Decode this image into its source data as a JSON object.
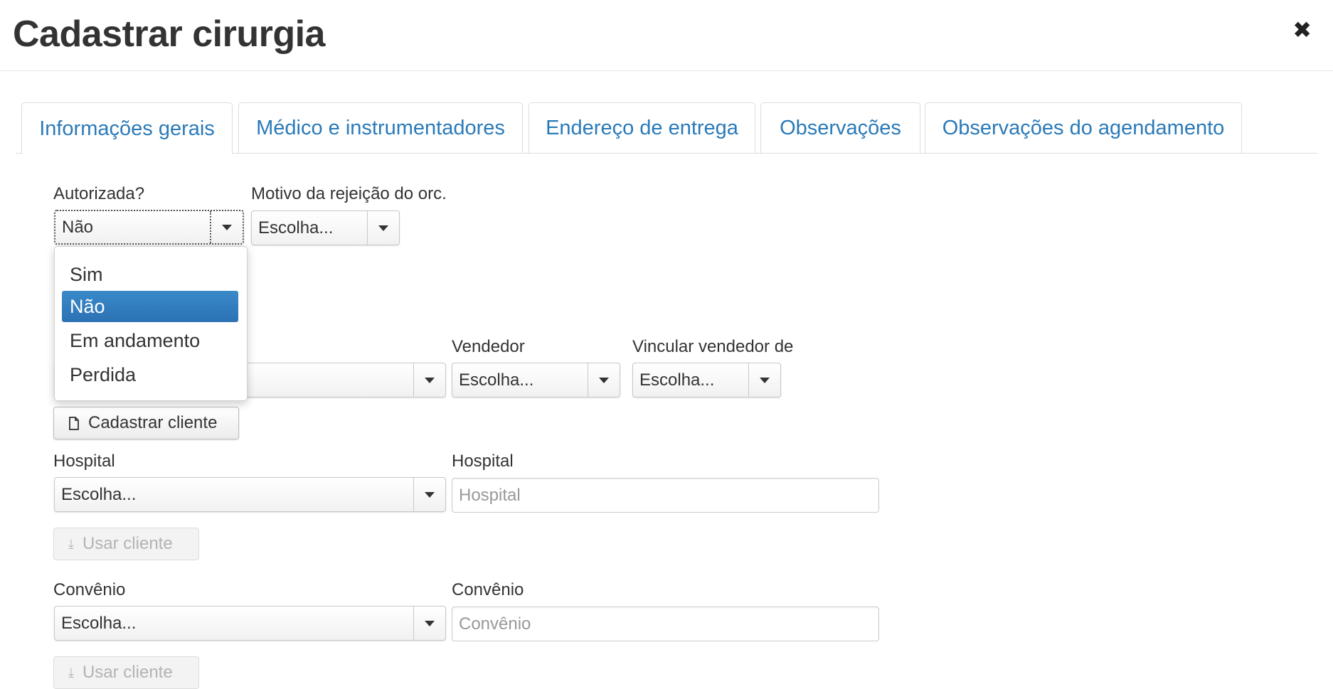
{
  "modal": {
    "title": "Cadastrar cirurgia",
    "close_symbol": "✖"
  },
  "tabs": [
    {
      "label": "Informações gerais",
      "active": true
    },
    {
      "label": "Médico e instrumentadores",
      "active": false
    },
    {
      "label": "Endereço de entrega",
      "active": false
    },
    {
      "label": "Observações",
      "active": false
    },
    {
      "label": "Observações do agendamento",
      "active": false
    }
  ],
  "form": {
    "autorizada": {
      "label": "Autorizada?",
      "value": "Não",
      "options": [
        "Sim",
        "Não",
        "Em andamento",
        "Perdida"
      ],
      "selected_option": "Não"
    },
    "motivo_rejeicao": {
      "label": "Motivo da rejeição do orc.",
      "value": "Escolha..."
    },
    "vendedor": {
      "label": "Vendedor",
      "value": "Escolha..."
    },
    "vincular_vendedor": {
      "label": "Vincular vendedor de",
      "value": "Escolha..."
    },
    "cadastrar_cliente_button": {
      "label": "Cadastrar cliente",
      "icon": "file-icon"
    },
    "hospital_select": {
      "label": "Hospital",
      "value": "Escolha..."
    },
    "hospital_input": {
      "label": "Hospital",
      "placeholder": "Hospital"
    },
    "usar_cliente_hospital": {
      "label": "Usar cliente",
      "icon": "download-icon",
      "disabled": true
    },
    "convenio_select": {
      "label": "Convênio",
      "value": "Escolha..."
    },
    "convenio_input": {
      "label": "Convênio",
      "placeholder": "Convênio"
    },
    "usar_cliente_convenio": {
      "label": "Usar cliente",
      "icon": "download-icon",
      "disabled": true
    }
  },
  "colors": {
    "tab_text": "#2a7ab8",
    "selected_option_bg": "#2f78b8",
    "disabled_text": "#b3b3b3"
  }
}
